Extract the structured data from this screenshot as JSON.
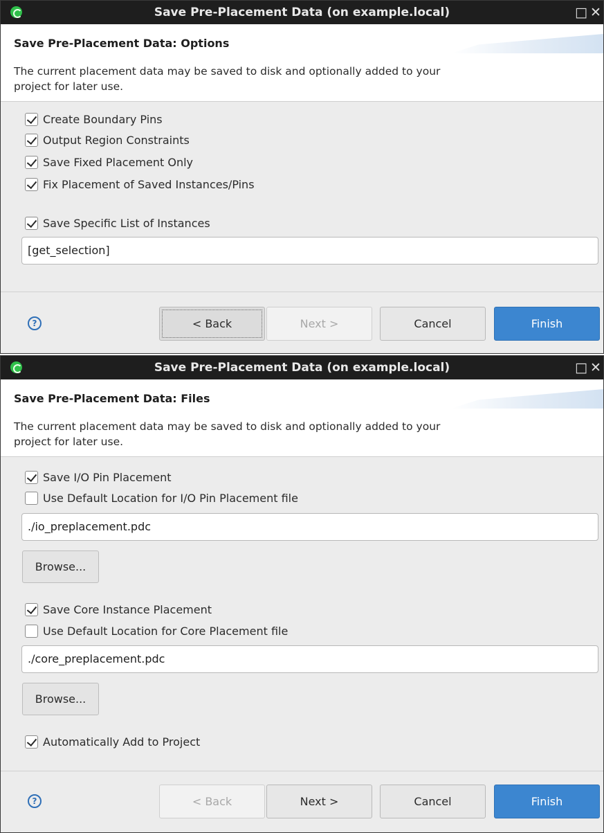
{
  "dialog_options": {
    "title": "Save Pre-Placement Data  (on example.local)",
    "window_controls": {
      "maximize": "□",
      "close": "✕"
    },
    "header_title": "Save Pre-Placement Data: Options",
    "header_description": "The current placement data may be saved to disk and optionally added to your project for later use.",
    "options": [
      {
        "label": "Create Boundary Pins",
        "checked": true
      },
      {
        "label": "Output Region Constraints",
        "checked": true
      },
      {
        "label": "Save Fixed Placement Only",
        "checked": true
      },
      {
        "label": "Fix Placement of Saved Instances/Pins",
        "checked": true
      }
    ],
    "specific_list": {
      "label": "Save Specific List of Instances",
      "checked": true
    },
    "instances_field_value": "[get_selection]",
    "buttons": {
      "help": "?",
      "back": "< Back",
      "next": "Next >",
      "cancel": "Cancel",
      "finish": "Finish"
    }
  },
  "dialog_files": {
    "title": "Save Pre-Placement Data  (on example.local)",
    "window_controls": {
      "maximize": "□",
      "close": "✕"
    },
    "header_title": "Save Pre-Placement Data: Files",
    "header_description": "The current placement data may be saved to disk and optionally added to your project for later use.",
    "io": {
      "save_label": "Save I/O Pin Placement",
      "save_checked": true,
      "default_location_label": "Use Default Location for I/O Pin Placement file",
      "default_location_checked": false,
      "file_value": "./io_preplacement.pdc",
      "browse_label": "Browse..."
    },
    "core": {
      "save_label": "Save Core Instance Placement",
      "save_checked": true,
      "default_location_label": "Use Default Location for Core Placement file",
      "default_location_checked": false,
      "file_value": "./core_preplacement.pdc",
      "browse_label": "Browse..."
    },
    "auto_add": {
      "label": "Automatically Add to Project",
      "checked": true
    },
    "buttons": {
      "help": "?",
      "back": "< Back",
      "next": "Next >",
      "cancel": "Cancel",
      "finish": "Finish"
    }
  },
  "colors": {
    "titlebar": "#1e1e1e",
    "dialog_bg": "#ececec",
    "header_bg": "#ffffff",
    "primary_button": "#3c86d0",
    "help_icon": "#2f6fb7",
    "app_icon": "#2fbf4a"
  }
}
